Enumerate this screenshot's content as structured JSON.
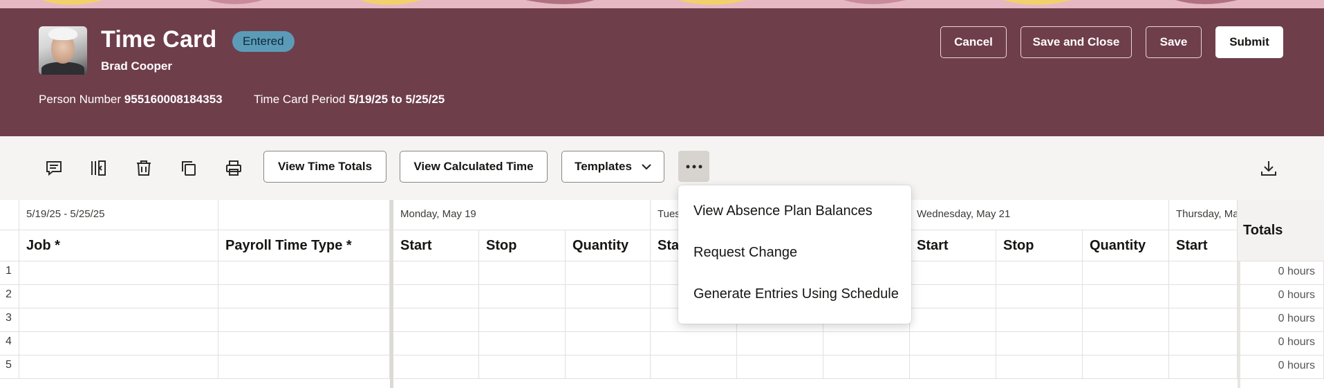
{
  "header": {
    "title": "Time Card",
    "status": "Entered",
    "person_name": "Brad Cooper",
    "person_number_label": "Person Number",
    "person_number": "955160008184353",
    "period_label": "Time Card Period",
    "period": "5/19/25 to 5/25/25",
    "buttons": {
      "cancel": "Cancel",
      "save_close": "Save and Close",
      "save": "Save",
      "submit": "Submit"
    },
    "colors": {
      "banner": "#6f3e4b",
      "status_badge": "#5b9bb8"
    }
  },
  "toolbar": {
    "icons": [
      "comment-icon",
      "insert-column-icon",
      "delete-row-icon",
      "copy-icon",
      "print-icon",
      "more-icon",
      "download-icon"
    ],
    "view_time_totals": "View Time Totals",
    "view_calculated_time": "View Calculated Time",
    "templates": "Templates"
  },
  "grid": {
    "period_range": "5/19/25 - 5/25/25",
    "job_header": "Job *",
    "payroll_header": "Payroll Time Type *",
    "days": [
      "Monday, May 19",
      "Tues",
      "Wednesday, May 21",
      "Thursday, Ma"
    ],
    "start_label": "Start",
    "start_partial": "Sta",
    "stop_label": "Stop",
    "quantity_label": "Quantity",
    "totals_header": "Totals",
    "rows": [
      {
        "num": "1",
        "total": "0 hours"
      },
      {
        "num": "2",
        "total": "0 hours"
      },
      {
        "num": "3",
        "total": "0 hours"
      },
      {
        "num": "4",
        "total": "0 hours"
      },
      {
        "num": "5",
        "total": "0 hours"
      }
    ]
  },
  "menu": {
    "items": [
      "View Absence Plan Balances",
      "Request Change",
      "Generate Entries Using Schedule"
    ]
  }
}
